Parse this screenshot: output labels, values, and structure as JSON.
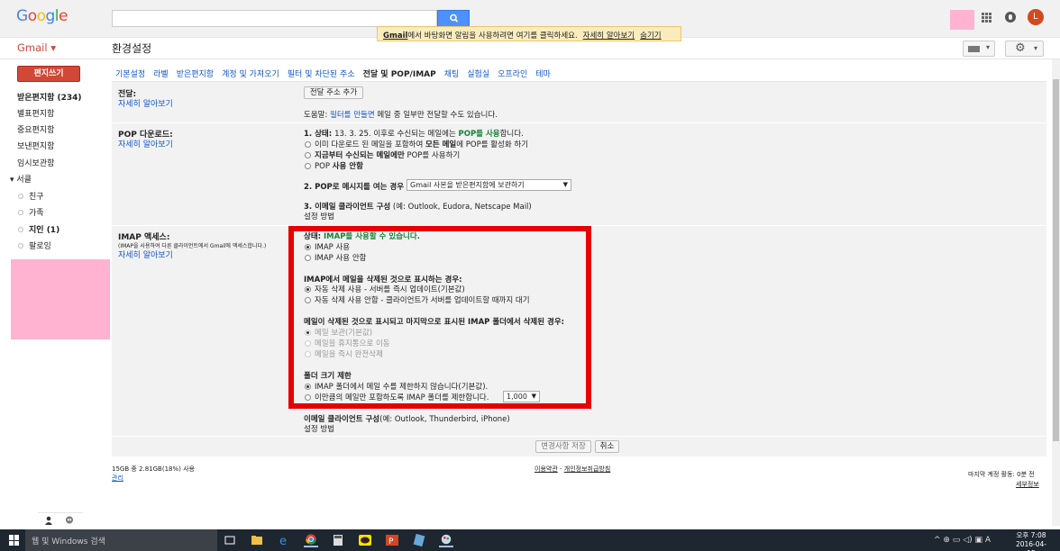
{
  "header": {
    "logo": [
      "G",
      "o",
      "o",
      "g",
      "l",
      "e"
    ],
    "gmail_label": "Gmail ▾",
    "page_title": "환경설정",
    "avatar_letter": "L"
  },
  "notice": {
    "text_bold": "Gmail",
    "text": "에서 바탕화면 알림을 사용하려면 여기를 클릭하세요.",
    "learn_more": "자세히 알아보기",
    "hide": "숨기기"
  },
  "sidebar": {
    "compose": "편지쓰기",
    "items": [
      {
        "label": "받은편지함 (234)",
        "bold": true
      },
      {
        "label": "별표편지함",
        "bold": false
      },
      {
        "label": "중요편지함",
        "bold": false
      },
      {
        "label": "보낸편지함",
        "bold": false
      },
      {
        "label": "임시보관함",
        "bold": false
      }
    ],
    "circles_header": "▾ 서클",
    "circles": [
      {
        "label": "친구",
        "bold": false
      },
      {
        "label": "가족",
        "bold": false
      },
      {
        "label": "지인 (1)",
        "bold": true
      },
      {
        "label": "팔로잉",
        "bold": false
      }
    ]
  },
  "tabs": [
    {
      "label": "기본설정",
      "active": false
    },
    {
      "label": "라벨",
      "active": false
    },
    {
      "label": "받은편지함",
      "active": false
    },
    {
      "label": "계정 및 가져오기",
      "active": false
    },
    {
      "label": "필터 및 차단된 주소",
      "active": false
    },
    {
      "label": "전달 및 POP/IMAP",
      "active": true
    },
    {
      "label": "채팅",
      "active": false
    },
    {
      "label": "실험실",
      "active": false
    },
    {
      "label": "오프라인",
      "active": false
    },
    {
      "label": "테마",
      "active": false
    }
  ],
  "forwarding": {
    "label": "전달:",
    "learn_more": "자세히 알아보기",
    "add_button": "전달 주소 추가",
    "tip_prefix": "도움말: ",
    "tip_link": "필터를 만들면",
    "tip_suffix": " 메일 중 일부만 전달할 수도 있습니다."
  },
  "pop": {
    "label": "POP 다운로드:",
    "learn_more": "자세히 알아보기",
    "status_prefix": "1. 상태: ",
    "status_mid": "13. 3. 25. 이후로 수신되는 메일에는 ",
    "status_green": "POP를 사용",
    "status_suffix": "합니다.",
    "opt1_a": "이미 다운로드 된 메일을 포함하여 ",
    "opt1_b": "모든 메일",
    "opt1_c": "에 POP를 활성화 하기",
    "opt2_a": "지금부터 수신되는 메일에만",
    "opt2_b": " POP를 사용하기",
    "opt3_a": "POP ",
    "opt3_b": "사용 안함",
    "q2_a": "2. POP",
    "q2_b": "로 메시지를 여는 경우",
    "q2_select": "Gmail 사본을 받은편지함에 보관하기",
    "q3_a": "3. 이메일 클라이언트 구성",
    "q3_b": " (예: Outlook, Eudora, Netscape Mail)",
    "setup_link": "설정 방법"
  },
  "imap": {
    "label": "IMAP 액세스:",
    "desc": "(IMAP을 사용하여 다른 클라이언트에서 Gmail에 액세스합니다.)",
    "learn_more": "자세히 알아보기",
    "status_prefix": "상태: ",
    "status_green": "IMAP를 사용할 수 있습니다.",
    "enable": "IMAP 사용",
    "disable": "IMAP 사용 안함",
    "delete_heading": "IMAP에서 메일을 삭제된 것으로 표시하는 경우:",
    "delete_opt1": "자동 삭제 사용 - 서버를 즉시 업데이트(기본값)",
    "delete_opt2": "자동 삭제 사용 안함 - 클라이언트가 서버를 업데이트할 때까지 대기",
    "expunge_heading": "메일이 삭제된 것으로 표시되고 마지막으로 표시된 IMAP 폴더에서 삭제된 경우:",
    "expunge_opt1": "메일 보관(기본값)",
    "expunge_opt2": "메일을 휴지통으로 이동",
    "expunge_opt3": "메일을 즉시 완전삭제",
    "folder_heading": "폴더 크기 제한",
    "folder_opt1": "IMAP 폴더에서 메일 수를 제한하지 않습니다(기본값).",
    "folder_opt2": "이만큼의 메일만 포함하도록 IMAP 폴더를 제한합니다.",
    "folder_limit": "1,000",
    "client_a": "이메일 클라이언트 구성",
    "client_b": "(예: Outlook, Thunderbird, iPhone)",
    "setup_link": "설정 방법"
  },
  "actions": {
    "save": "변경사항 저장",
    "cancel": "취소"
  },
  "footer": {
    "storage": "15GB 중 2.81GB(18%) 사용",
    "manage": "관리",
    "terms": "이용약관",
    "dash": " - ",
    "privacy": "개인정보취급방침",
    "last_activity": "마지막 계정 활동: 0분 전",
    "details": "세부정보"
  },
  "taskbar": {
    "search_placeholder": "웹 및 Windows 검색",
    "time": "오후 7:08",
    "date": "2016-04-15",
    "tray_symbols": "^ ⊕ ▭ ◁) ▣ A"
  },
  "colors": {
    "accent_red": "#d14836",
    "highlight_box": "#e60000",
    "link_blue": "#1155cc",
    "status_green": "#188038"
  }
}
